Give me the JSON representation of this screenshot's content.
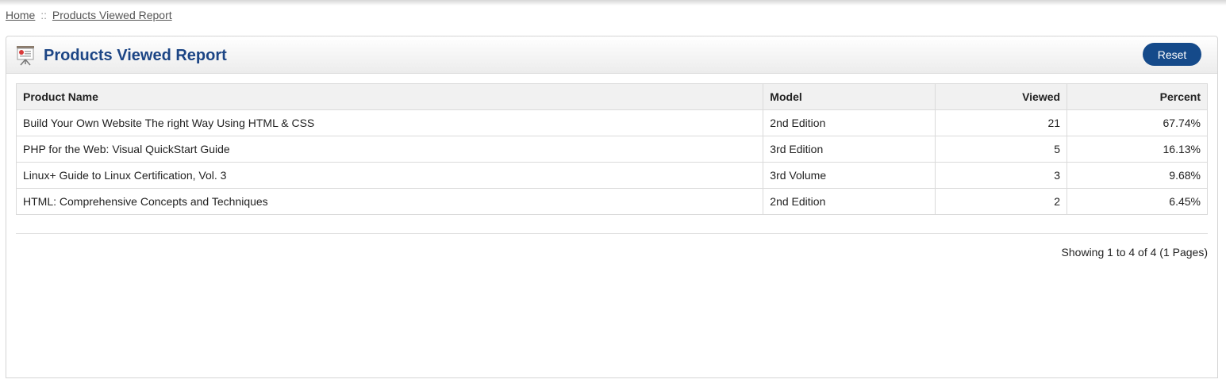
{
  "breadcrumb": {
    "home": "Home",
    "separator": "::",
    "current": "Products Viewed Report"
  },
  "panel": {
    "icon": "presentation-board-icon",
    "title": "Products Viewed Report",
    "reset_label": "Reset"
  },
  "table": {
    "headers": {
      "product_name": "Product Name",
      "model": "Model",
      "viewed": "Viewed",
      "percent": "Percent"
    },
    "rows": [
      {
        "product_name": "Build Your Own Website The right Way Using HTML & CSS",
        "model": "2nd Edition",
        "viewed": "21",
        "percent": "67.74%"
      },
      {
        "product_name": "PHP for the Web: Visual QuickStart Guide",
        "model": "3rd Edition",
        "viewed": "5",
        "percent": "16.13%"
      },
      {
        "product_name": "Linux+ Guide to Linux Certification, Vol. 3",
        "model": "3rd Volume",
        "viewed": "3",
        "percent": "9.68%"
      },
      {
        "product_name": "HTML: Comprehensive Concepts and Techniques",
        "model": "2nd Edition",
        "viewed": "2",
        "percent": "6.45%"
      }
    ]
  },
  "pagination": {
    "info": "Showing 1 to 4 of 4 (1 Pages)"
  },
  "colors": {
    "title": "#1c4585",
    "button": "#154a8a"
  }
}
